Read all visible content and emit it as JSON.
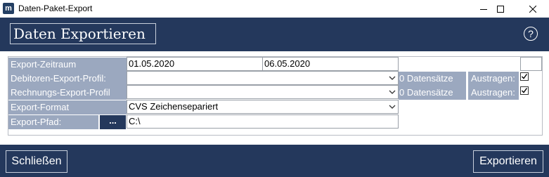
{
  "window": {
    "title": "Daten-Paket-Export",
    "app_icon_text": "m",
    "controls": [
      "minimize-icon",
      "maximize-icon",
      "close-icon"
    ]
  },
  "header": {
    "title": "Daten Exportieren",
    "help_label": "?"
  },
  "form": {
    "export_period": {
      "label": "Export-Zeitraum",
      "from": "01.05.2020",
      "to": "06.05.2020"
    },
    "debtor_profile": {
      "label": "Debitoren-Export-Profil:",
      "value": "",
      "record_count": "0 Datensätze",
      "remove_label": "Austragen:",
      "remove_checked": true
    },
    "invoice_profile": {
      "label": "Rechnungs-Export-Profil",
      "value": "",
      "record_count": "0 Datensätze",
      "remove_label": "Austragen:",
      "remove_checked": true
    },
    "export_format": {
      "label": "Export-Format",
      "value": "CVS Zeichensepariert"
    },
    "export_path": {
      "label": "Export-Pfad:",
      "browse_label": "...",
      "value": "C:\\"
    }
  },
  "footer": {
    "close_label": "Schließen",
    "export_label": "Exportieren"
  },
  "colors": {
    "header_bg": "#24385c",
    "label_bg": "#9ba8bf",
    "text_light": "#ffffff"
  }
}
